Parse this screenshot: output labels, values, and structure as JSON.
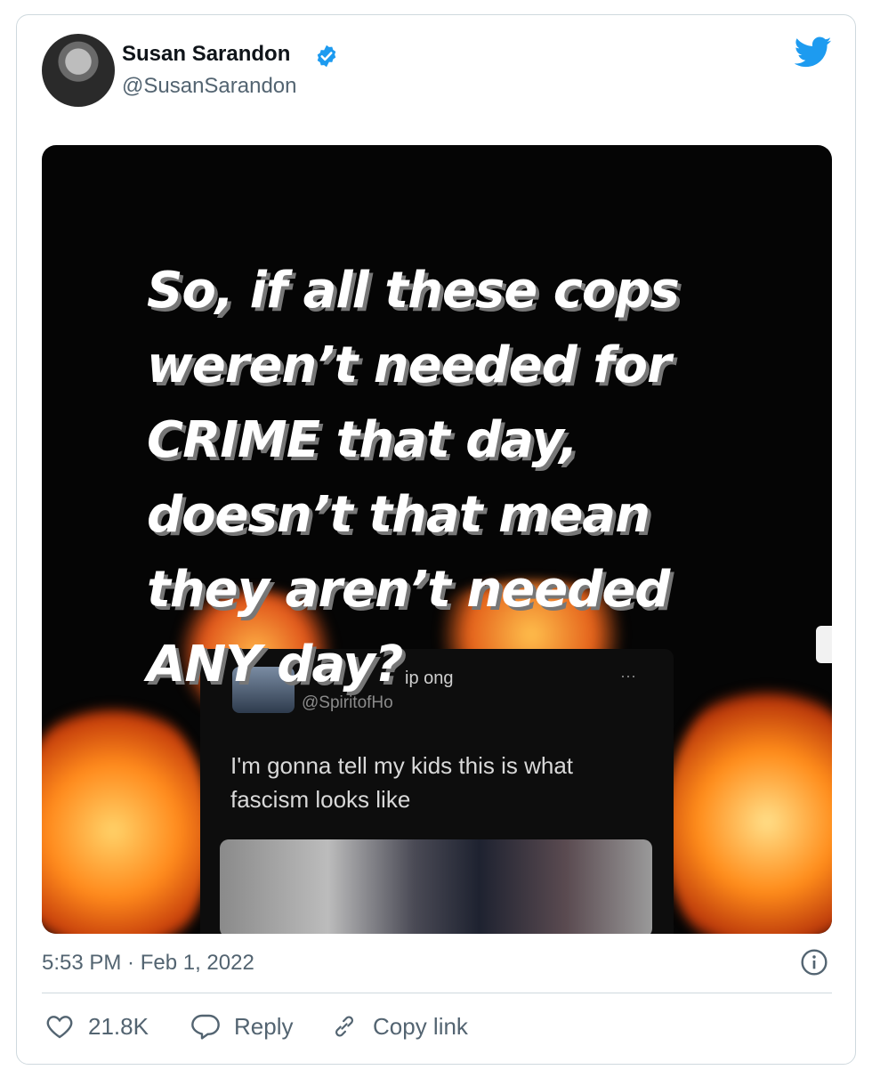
{
  "author": {
    "name": "Susan Sarandon",
    "handle": "@SusanSarandon",
    "verified_icon": "verified-badge-icon"
  },
  "media": {
    "quote_lines": [
      "So, if all these cops",
      "weren’t needed for",
      "CRIME that day,",
      "doesn’t that mean",
      "they aren’t needed",
      "ANY day?"
    ],
    "inner_tweet": {
      "name_fragment": "ip ong",
      "handle": "@SpiritofHo",
      "menu": "···",
      "body": "I'm gonna tell my kids this is what fascism looks like"
    }
  },
  "timestamp": "5:53 PM · Feb 1, 2022",
  "actions": {
    "likes": "21.8K",
    "reply": "Reply",
    "copy_link": "Copy link"
  },
  "colors": {
    "twitter_blue": "#1d9bf0",
    "secondary_text": "#536471",
    "border": "#cfd9de"
  }
}
